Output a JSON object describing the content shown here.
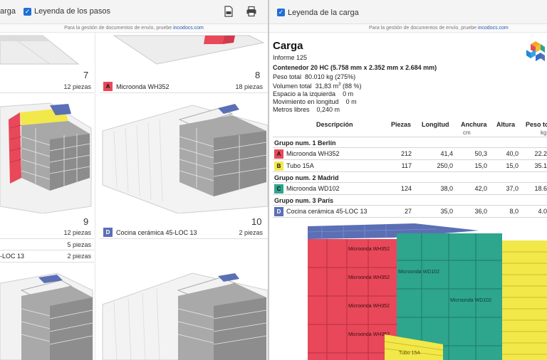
{
  "left_panel": {
    "toolbar": {
      "cut_label": "arga",
      "steps_legend_label": "Leyenda de los pasos"
    },
    "promo": {
      "text": "Para la gestión de documentos de envío, pruebe",
      "link": "incodocs.com"
    },
    "steps": [
      {
        "number": "7",
        "pieces": "12 piezas"
      },
      {
        "number": "8",
        "pieces": "18 piezas",
        "tag": "A",
        "item": "Microonda WH352"
      },
      {
        "number": "9",
        "pieces": "12 piezas"
      },
      {
        "number": "10",
        "pieces": "2 piezas",
        "tag": "D",
        "item": "Cocina cerámica 45-LOC 13"
      }
    ],
    "step9_extra": [
      {
        "pieces": "5 piezas"
      },
      {
        "item": "-LOC 13",
        "pieces": "2 piezas"
      }
    ]
  },
  "right_panel": {
    "toolbar": {
      "legend_label": "Leyenda de la carga"
    },
    "promo": {
      "text": "Para la gestión de documentos de envío, pruebe",
      "link": "incodocs.com"
    },
    "title": "Carga",
    "report": "Informe 125",
    "container": "Contenedor 20 HC (5.758 mm x 2.352 mm x 2.684 mm)",
    "stats": {
      "peso_label": "Peso total",
      "peso_value": "80.010 kg (275%)",
      "volumen_label": "Volumen total",
      "volumen_value": "31,83 m",
      "volumen_sup": "3",
      "volumen_pct": "(88 %)",
      "izq_label": "Espacio a la izquierda",
      "izq_value": "0 m",
      "mov_label": "Movimiento en longitud",
      "mov_value": "0 m",
      "metros_label": "Metros libres",
      "metros_value": "0,240 m"
    },
    "table": {
      "headers": {
        "desc": "Descripción",
        "piezas": "Piezas",
        "longitud": "Longitud",
        "anchura": "Anchura",
        "altura": "Altura",
        "peso": "Peso to"
      },
      "units": {
        "cm": "cm",
        "kg": "kg"
      },
      "groups": [
        {
          "name": "Grupo num. 1 Berlín",
          "rows": [
            {
              "tag": "A",
              "color": "#e8485a",
              "name": "Microonda WH352",
              "piezas": "212",
              "longitud": "41,4",
              "anchura": "50,3",
              "altura": "40,0",
              "peso": "22.2"
            },
            {
              "tag": "B",
              "color": "#f2e84a",
              "name": "Tubo 15A",
              "piezas": "117",
              "longitud": "250,0",
              "anchura": "15,0",
              "altura": "15,0",
              "peso": "35.1"
            }
          ]
        },
        {
          "name": "Grupo num. 2 Madrid",
          "rows": [
            {
              "tag": "C",
              "color": "#2ea58d",
              "name": "Microonda WD102",
              "piezas": "124",
              "longitud": "38,0",
              "anchura": "42,0",
              "altura": "37,0",
              "peso": "18.6"
            }
          ]
        },
        {
          "name": "Grupo num. 3 París",
          "rows": [
            {
              "tag": "D",
              "color": "#5b6fb5",
              "name": "Cocina cerámica 45-LOC 13",
              "piezas": "27",
              "longitud": "35,0",
              "anchura": "36,0",
              "altura": "8,0",
              "peso": "4.0"
            }
          ]
        }
      ]
    },
    "render": {
      "box_label_a": "Microonda WH352",
      "box_label_c": "Microonda WD102",
      "box_label_b": "Tubo 15A"
    }
  },
  "colors": {
    "red": "#e8485a",
    "yellow": "#f2e84a",
    "teal": "#2ea58d",
    "blue": "#5b6fb5",
    "grey": "#9a9a9a"
  },
  "icons": [
    "checkbox-icon",
    "pdf-icon",
    "print-icon",
    "app-logo-icon"
  ]
}
